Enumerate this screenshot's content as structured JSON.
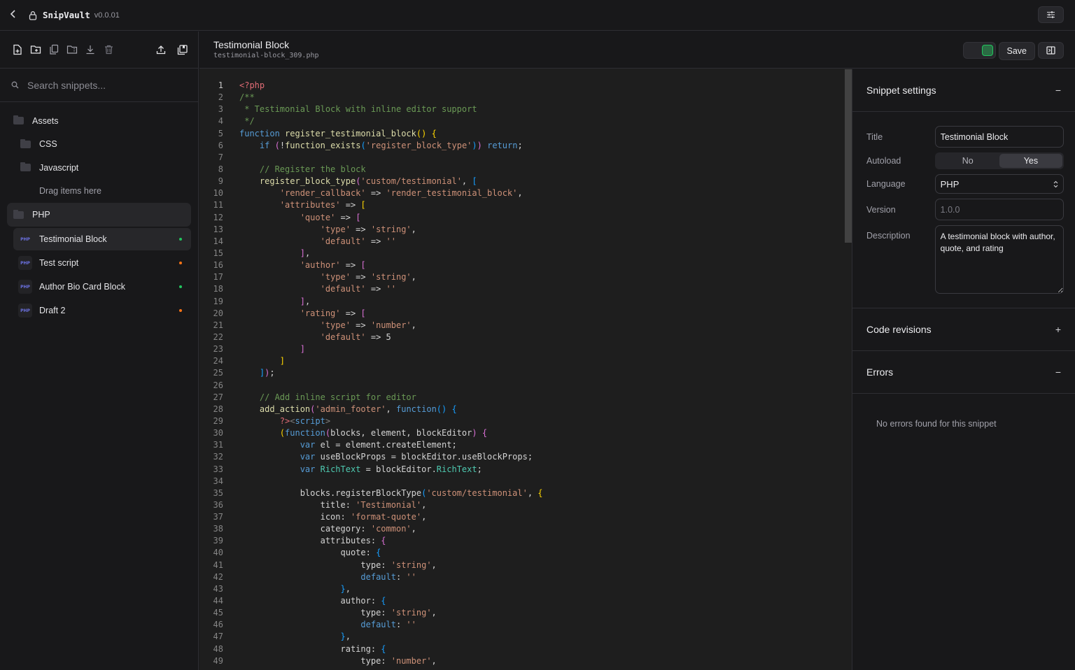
{
  "app": {
    "name": "SnipVault",
    "version": "v0.0.01"
  },
  "sidebar": {
    "search_placeholder": "Search snippets...",
    "tree": {
      "root_folder": "Assets",
      "subfolders": [
        "CSS",
        "Javascript"
      ],
      "drop_hint": "Drag items here",
      "php_folder": "PHP",
      "files": [
        {
          "name": "Testimonial Block",
          "badge": "PHP",
          "status_color": "#22c55e",
          "active": true
        },
        {
          "name": "Test script",
          "badge": "PHP",
          "status_color": "#f97316",
          "active": false
        },
        {
          "name": "Author Bio Card Block",
          "badge": "PHP",
          "status_color": "#22c55e",
          "active": false
        },
        {
          "name": "Draft 2",
          "badge": "PHP",
          "status_color": "#f97316",
          "active": false
        }
      ]
    },
    "toolbar_icons": [
      "new-file-icon",
      "new-folder-icon",
      "duplicate-icon",
      "folder-archive-icon",
      "download-icon",
      "trash-icon",
      "upload-icon",
      "bookmark-collection-icon"
    ]
  },
  "editor": {
    "title": "Testimonial Block",
    "filename": "testimonial-block_309.php",
    "save_label": "Save",
    "active_toggle": true,
    "active_line": 1,
    "lines": [
      [
        [
          "t",
          "<?php"
        ]
      ],
      [
        [
          "c",
          "/**"
        ]
      ],
      [
        [
          "c",
          " * Testimonial Block with inline editor support"
        ]
      ],
      [
        [
          "c",
          " */"
        ]
      ],
      [
        [
          "k",
          "function"
        ],
        [
          "d",
          " "
        ],
        [
          "f",
          "register_testimonial_block"
        ],
        [
          "y",
          "()"
        ],
        [
          "d",
          " "
        ],
        [
          "y",
          "{"
        ]
      ],
      [
        [
          "d",
          "    "
        ],
        [
          "k",
          "if"
        ],
        [
          "d",
          " "
        ],
        [
          "p",
          "("
        ],
        [
          "d",
          "!"
        ],
        [
          "f",
          "function_exists"
        ],
        [
          "b",
          "("
        ],
        [
          "s",
          "'register_block_type'"
        ],
        [
          "b",
          ")"
        ],
        [
          "p",
          ")"
        ],
        [
          "d",
          " "
        ],
        [
          "k",
          "return"
        ],
        [
          "d",
          ";"
        ]
      ],
      [],
      [
        [
          "d",
          "    "
        ],
        [
          "c",
          "// Register the block"
        ]
      ],
      [
        [
          "d",
          "    "
        ],
        [
          "f",
          "register_block_type"
        ],
        [
          "p",
          "("
        ],
        [
          "s",
          "'custom/testimonial'"
        ],
        [
          "d",
          ", "
        ],
        [
          "b",
          "["
        ]
      ],
      [
        [
          "d",
          "        "
        ],
        [
          "s",
          "'render_callback'"
        ],
        [
          "d",
          " => "
        ],
        [
          "s",
          "'render_testimonial_block'"
        ],
        [
          "d",
          ","
        ]
      ],
      [
        [
          "d",
          "        "
        ],
        [
          "s",
          "'attributes'"
        ],
        [
          "d",
          " => "
        ],
        [
          "y",
          "["
        ]
      ],
      [
        [
          "d",
          "            "
        ],
        [
          "s",
          "'quote'"
        ],
        [
          "d",
          " => "
        ],
        [
          "p",
          "["
        ]
      ],
      [
        [
          "d",
          "                "
        ],
        [
          "s",
          "'type'"
        ],
        [
          "d",
          " => "
        ],
        [
          "s",
          "'string'"
        ],
        [
          "d",
          ","
        ]
      ],
      [
        [
          "d",
          "                "
        ],
        [
          "s",
          "'default'"
        ],
        [
          "d",
          " => "
        ],
        [
          "s",
          "''"
        ]
      ],
      [
        [
          "d",
          "            "
        ],
        [
          "p",
          "]"
        ],
        [
          "d",
          ","
        ]
      ],
      [
        [
          "d",
          "            "
        ],
        [
          "s",
          "'author'"
        ],
        [
          "d",
          " => "
        ],
        [
          "p",
          "["
        ]
      ],
      [
        [
          "d",
          "                "
        ],
        [
          "s",
          "'type'"
        ],
        [
          "d",
          " => "
        ],
        [
          "s",
          "'string'"
        ],
        [
          "d",
          ","
        ]
      ],
      [
        [
          "d",
          "                "
        ],
        [
          "s",
          "'default'"
        ],
        [
          "d",
          " => "
        ],
        [
          "s",
          "''"
        ]
      ],
      [
        [
          "d",
          "            "
        ],
        [
          "p",
          "]"
        ],
        [
          "d",
          ","
        ]
      ],
      [
        [
          "d",
          "            "
        ],
        [
          "s",
          "'rating'"
        ],
        [
          "d",
          " => "
        ],
        [
          "p",
          "["
        ]
      ],
      [
        [
          "d",
          "                "
        ],
        [
          "s",
          "'type'"
        ],
        [
          "d",
          " => "
        ],
        [
          "s",
          "'number'"
        ],
        [
          "d",
          ","
        ]
      ],
      [
        [
          "d",
          "                "
        ],
        [
          "s",
          "'default'"
        ],
        [
          "d",
          " => 5"
        ]
      ],
      [
        [
          "d",
          "            "
        ],
        [
          "p",
          "]"
        ]
      ],
      [
        [
          "d",
          "        "
        ],
        [
          "y",
          "]"
        ]
      ],
      [
        [
          "d",
          "    "
        ],
        [
          "b",
          "]"
        ],
        [
          "p",
          ")"
        ],
        [
          "d",
          ";"
        ]
      ],
      [],
      [
        [
          "d",
          "    "
        ],
        [
          "c",
          "// Add inline script for editor"
        ]
      ],
      [
        [
          "d",
          "    "
        ],
        [
          "f",
          "add_action"
        ],
        [
          "p",
          "("
        ],
        [
          "s",
          "'admin_footer'"
        ],
        [
          "d",
          ", "
        ],
        [
          "k",
          "function"
        ],
        [
          "b",
          "()"
        ],
        [
          "d",
          " "
        ],
        [
          "b",
          "{"
        ]
      ],
      [
        [
          "d",
          "        "
        ],
        [
          "t",
          "?>"
        ],
        [
          "tag",
          "<"
        ],
        [
          "k",
          "script"
        ],
        [
          "tag",
          ">"
        ]
      ],
      [
        [
          "d",
          "        "
        ],
        [
          "y",
          "("
        ],
        [
          "k",
          "function"
        ],
        [
          "p",
          "("
        ],
        [
          "d",
          "blocks, element, blockEditor"
        ],
        [
          "p",
          ")"
        ],
        [
          "d",
          " "
        ],
        [
          "p",
          "{"
        ]
      ],
      [
        [
          "d",
          "            "
        ],
        [
          "k",
          "var"
        ],
        [
          "d",
          " el = element.createElement;"
        ]
      ],
      [
        [
          "d",
          "            "
        ],
        [
          "k",
          "var"
        ],
        [
          "d",
          " useBlockProps = blockEditor.useBlockProps;"
        ]
      ],
      [
        [
          "d",
          "            "
        ],
        [
          "k",
          "var"
        ],
        [
          "d",
          " "
        ],
        [
          "g",
          "RichText"
        ],
        [
          "d",
          " = blockEditor."
        ],
        [
          "g",
          "RichText"
        ],
        [
          "d",
          ";"
        ]
      ],
      [],
      [
        [
          "d",
          "            blocks.registerBlockType"
        ],
        [
          "b",
          "("
        ],
        [
          "s",
          "'custom/testimonial'"
        ],
        [
          "d",
          ", "
        ],
        [
          "y",
          "{"
        ]
      ],
      [
        [
          "d",
          "                title: "
        ],
        [
          "s",
          "'Testimonial'"
        ],
        [
          "d",
          ","
        ]
      ],
      [
        [
          "d",
          "                icon: "
        ],
        [
          "s",
          "'format-quote'"
        ],
        [
          "d",
          ","
        ]
      ],
      [
        [
          "d",
          "                category: "
        ],
        [
          "s",
          "'common'"
        ],
        [
          "d",
          ","
        ]
      ],
      [
        [
          "d",
          "                attributes: "
        ],
        [
          "p",
          "{"
        ]
      ],
      [
        [
          "d",
          "                    quote: "
        ],
        [
          "b",
          "{"
        ]
      ],
      [
        [
          "d",
          "                        type: "
        ],
        [
          "s",
          "'string'"
        ],
        [
          "d",
          ","
        ]
      ],
      [
        [
          "d",
          "                        "
        ],
        [
          "k",
          "default"
        ],
        [
          "d",
          ": "
        ],
        [
          "s",
          "''"
        ]
      ],
      [
        [
          "d",
          "                    "
        ],
        [
          "b",
          "}"
        ],
        [
          "d",
          ","
        ]
      ],
      [
        [
          "d",
          "                    author: "
        ],
        [
          "b",
          "{"
        ]
      ],
      [
        [
          "d",
          "                        type: "
        ],
        [
          "s",
          "'string'"
        ],
        [
          "d",
          ","
        ]
      ],
      [
        [
          "d",
          "                        "
        ],
        [
          "k",
          "default"
        ],
        [
          "d",
          ": "
        ],
        [
          "s",
          "''"
        ]
      ],
      [
        [
          "d",
          "                    "
        ],
        [
          "b",
          "}"
        ],
        [
          "d",
          ","
        ]
      ],
      [
        [
          "d",
          "                    rating: "
        ],
        [
          "b",
          "{"
        ]
      ],
      [
        [
          "d",
          "                        type: "
        ],
        [
          "s",
          "'number'"
        ],
        [
          "d",
          ","
        ]
      ]
    ]
  },
  "settings": {
    "section_title": "Snippet settings",
    "collapse_symbol": "−",
    "fields": {
      "title_label": "Title",
      "title_value": "Testimonial Block",
      "autoload_label": "Autoload",
      "autoload_options": [
        "No",
        "Yes"
      ],
      "autoload_selected": "Yes",
      "language_label": "Language",
      "language_value": "PHP",
      "version_label": "Version",
      "version_placeholder": "1.0.0",
      "description_label": "Description",
      "description_value": "A testimonial block with author, quote, and rating"
    },
    "revisions_title": "Code revisions",
    "revisions_symbol": "+",
    "errors_title": "Errors",
    "errors_symbol": "−",
    "errors_message": "No errors found for this snippet"
  }
}
